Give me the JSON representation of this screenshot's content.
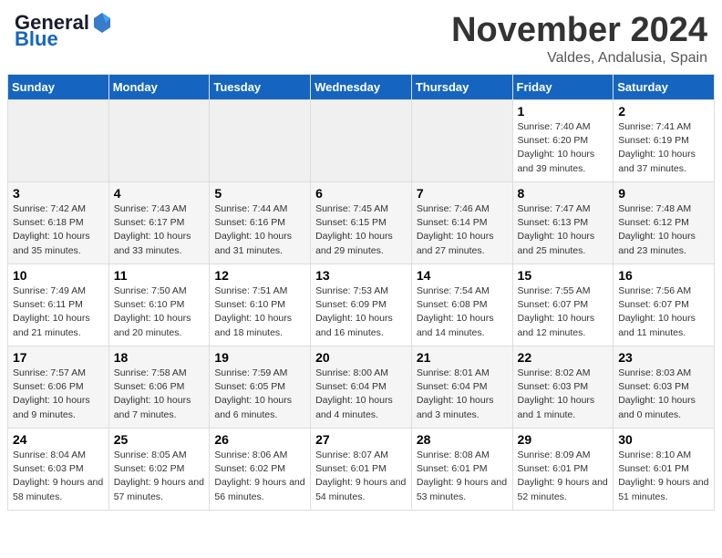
{
  "logo": {
    "text1": "General",
    "text2": "Blue"
  },
  "title": "November 2024",
  "location": "Valdes, Andalusia, Spain",
  "days_of_week": [
    "Sunday",
    "Monday",
    "Tuesday",
    "Wednesday",
    "Thursday",
    "Friday",
    "Saturday"
  ],
  "weeks": [
    [
      {
        "day": "",
        "empty": true
      },
      {
        "day": "",
        "empty": true
      },
      {
        "day": "",
        "empty": true
      },
      {
        "day": "",
        "empty": true
      },
      {
        "day": "",
        "empty": true
      },
      {
        "day": "1",
        "sunrise": "Sunrise: 7:40 AM",
        "sunset": "Sunset: 6:20 PM",
        "daylight": "Daylight: 10 hours and 39 minutes."
      },
      {
        "day": "2",
        "sunrise": "Sunrise: 7:41 AM",
        "sunset": "Sunset: 6:19 PM",
        "daylight": "Daylight: 10 hours and 37 minutes."
      }
    ],
    [
      {
        "day": "3",
        "sunrise": "Sunrise: 7:42 AM",
        "sunset": "Sunset: 6:18 PM",
        "daylight": "Daylight: 10 hours and 35 minutes."
      },
      {
        "day": "4",
        "sunrise": "Sunrise: 7:43 AM",
        "sunset": "Sunset: 6:17 PM",
        "daylight": "Daylight: 10 hours and 33 minutes."
      },
      {
        "day": "5",
        "sunrise": "Sunrise: 7:44 AM",
        "sunset": "Sunset: 6:16 PM",
        "daylight": "Daylight: 10 hours and 31 minutes."
      },
      {
        "day": "6",
        "sunrise": "Sunrise: 7:45 AM",
        "sunset": "Sunset: 6:15 PM",
        "daylight": "Daylight: 10 hours and 29 minutes."
      },
      {
        "day": "7",
        "sunrise": "Sunrise: 7:46 AM",
        "sunset": "Sunset: 6:14 PM",
        "daylight": "Daylight: 10 hours and 27 minutes."
      },
      {
        "day": "8",
        "sunrise": "Sunrise: 7:47 AM",
        "sunset": "Sunset: 6:13 PM",
        "daylight": "Daylight: 10 hours and 25 minutes."
      },
      {
        "day": "9",
        "sunrise": "Sunrise: 7:48 AM",
        "sunset": "Sunset: 6:12 PM",
        "daylight": "Daylight: 10 hours and 23 minutes."
      }
    ],
    [
      {
        "day": "10",
        "sunrise": "Sunrise: 7:49 AM",
        "sunset": "Sunset: 6:11 PM",
        "daylight": "Daylight: 10 hours and 21 minutes."
      },
      {
        "day": "11",
        "sunrise": "Sunrise: 7:50 AM",
        "sunset": "Sunset: 6:10 PM",
        "daylight": "Daylight: 10 hours and 20 minutes."
      },
      {
        "day": "12",
        "sunrise": "Sunrise: 7:51 AM",
        "sunset": "Sunset: 6:10 PM",
        "daylight": "Daylight: 10 hours and 18 minutes."
      },
      {
        "day": "13",
        "sunrise": "Sunrise: 7:53 AM",
        "sunset": "Sunset: 6:09 PM",
        "daylight": "Daylight: 10 hours and 16 minutes."
      },
      {
        "day": "14",
        "sunrise": "Sunrise: 7:54 AM",
        "sunset": "Sunset: 6:08 PM",
        "daylight": "Daylight: 10 hours and 14 minutes."
      },
      {
        "day": "15",
        "sunrise": "Sunrise: 7:55 AM",
        "sunset": "Sunset: 6:07 PM",
        "daylight": "Daylight: 10 hours and 12 minutes."
      },
      {
        "day": "16",
        "sunrise": "Sunrise: 7:56 AM",
        "sunset": "Sunset: 6:07 PM",
        "daylight": "Daylight: 10 hours and 11 minutes."
      }
    ],
    [
      {
        "day": "17",
        "sunrise": "Sunrise: 7:57 AM",
        "sunset": "Sunset: 6:06 PM",
        "daylight": "Daylight: 10 hours and 9 minutes."
      },
      {
        "day": "18",
        "sunrise": "Sunrise: 7:58 AM",
        "sunset": "Sunset: 6:06 PM",
        "daylight": "Daylight: 10 hours and 7 minutes."
      },
      {
        "day": "19",
        "sunrise": "Sunrise: 7:59 AM",
        "sunset": "Sunset: 6:05 PM",
        "daylight": "Daylight: 10 hours and 6 minutes."
      },
      {
        "day": "20",
        "sunrise": "Sunrise: 8:00 AM",
        "sunset": "Sunset: 6:04 PM",
        "daylight": "Daylight: 10 hours and 4 minutes."
      },
      {
        "day": "21",
        "sunrise": "Sunrise: 8:01 AM",
        "sunset": "Sunset: 6:04 PM",
        "daylight": "Daylight: 10 hours and 3 minutes."
      },
      {
        "day": "22",
        "sunrise": "Sunrise: 8:02 AM",
        "sunset": "Sunset: 6:03 PM",
        "daylight": "Daylight: 10 hours and 1 minute."
      },
      {
        "day": "23",
        "sunrise": "Sunrise: 8:03 AM",
        "sunset": "Sunset: 6:03 PM",
        "daylight": "Daylight: 10 hours and 0 minutes."
      }
    ],
    [
      {
        "day": "24",
        "sunrise": "Sunrise: 8:04 AM",
        "sunset": "Sunset: 6:03 PM",
        "daylight": "Daylight: 9 hours and 58 minutes."
      },
      {
        "day": "25",
        "sunrise": "Sunrise: 8:05 AM",
        "sunset": "Sunset: 6:02 PM",
        "daylight": "Daylight: 9 hours and 57 minutes."
      },
      {
        "day": "26",
        "sunrise": "Sunrise: 8:06 AM",
        "sunset": "Sunset: 6:02 PM",
        "daylight": "Daylight: 9 hours and 56 minutes."
      },
      {
        "day": "27",
        "sunrise": "Sunrise: 8:07 AM",
        "sunset": "Sunset: 6:01 PM",
        "daylight": "Daylight: 9 hours and 54 minutes."
      },
      {
        "day": "28",
        "sunrise": "Sunrise: 8:08 AM",
        "sunset": "Sunset: 6:01 PM",
        "daylight": "Daylight: 9 hours and 53 minutes."
      },
      {
        "day": "29",
        "sunrise": "Sunrise: 8:09 AM",
        "sunset": "Sunset: 6:01 PM",
        "daylight": "Daylight: 9 hours and 52 minutes."
      },
      {
        "day": "30",
        "sunrise": "Sunrise: 8:10 AM",
        "sunset": "Sunset: 6:01 PM",
        "daylight": "Daylight: 9 hours and 51 minutes."
      }
    ]
  ]
}
